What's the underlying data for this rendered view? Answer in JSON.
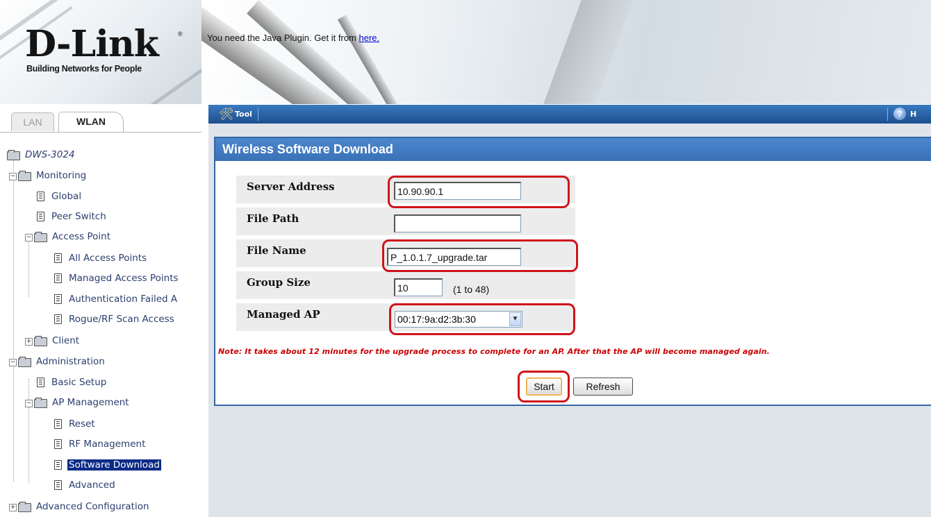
{
  "logo": {
    "brand": "D-Link",
    "registered": "®",
    "tagline": "Building Networks for People"
  },
  "tabs": [
    {
      "label": "LAN"
    },
    {
      "label": "WLAN"
    }
  ],
  "banner": {
    "java_message": "You need the Java Plugin. Get it from",
    "java_link": "here."
  },
  "toolbar": {
    "tool_label": "Tool",
    "help_label": "H"
  },
  "tree": {
    "root": "DWS-3024",
    "items": [
      {
        "label": "Monitoring"
      },
      {
        "label": "Global"
      },
      {
        "label": "Peer Switch"
      },
      {
        "label": "Access Point"
      },
      {
        "label": "All Access Points"
      },
      {
        "label": "Managed Access Points"
      },
      {
        "label": "Authentication Failed A"
      },
      {
        "label": "Rogue/RF Scan Access"
      },
      {
        "label": "Client"
      },
      {
        "label": "Administration"
      },
      {
        "label": "Basic Setup"
      },
      {
        "label": "AP Management"
      },
      {
        "label": "Reset"
      },
      {
        "label": "RF Management"
      },
      {
        "label": "Software Download"
      },
      {
        "label": "Advanced"
      },
      {
        "label": "Advanced Configuration"
      }
    ],
    "selected": "Software Download"
  },
  "panel": {
    "title": "Wireless Software Download",
    "fields": {
      "server_address": {
        "label": "Server Address",
        "value": "10.90.90.1"
      },
      "file_path": {
        "label": "File Path",
        "value": ""
      },
      "file_name": {
        "label": "File Name",
        "value": "P_1.0.1.7_upgrade.tar"
      },
      "group_size": {
        "label": "Group Size",
        "value": "10",
        "hint": "(1 to 48)"
      },
      "managed_ap": {
        "label": "Managed AP",
        "value": "00:17:9a:d2:3b:30"
      }
    },
    "note": "Note: It takes about 12 minutes for the upgrade process to complete for an AP. After that the AP will become managed again.",
    "buttons": {
      "start": "Start",
      "refresh": "Refresh"
    }
  },
  "colors": {
    "toolbar": "#2a62a8",
    "panel_header": "#4478bf",
    "selected_node": "#0a2a86",
    "annotation": "#d0131a",
    "note": "#cc0000"
  }
}
